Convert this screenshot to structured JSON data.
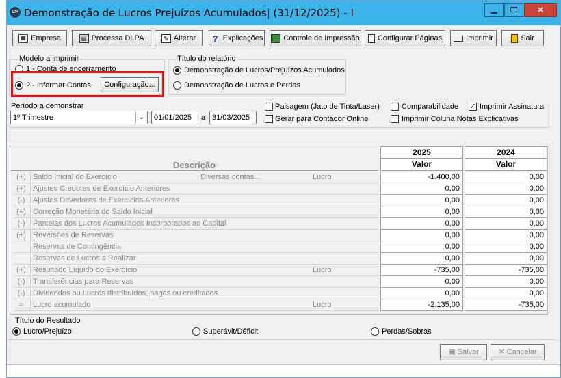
{
  "window": {
    "title": "Demonstração de Lucros Prejuízos Acumulados| (31/12/2025) - I",
    "app_icon": "CP"
  },
  "toolbar": {
    "buttons": [
      {
        "label": "Empresa",
        "icon": "calendar-icon"
      },
      {
        "label": "Processa DLPA",
        "icon": "calculator-icon"
      },
      {
        "label": "Alterar",
        "icon": "edit-icon"
      },
      {
        "label": "Explicações",
        "icon": "help-icon"
      },
      {
        "label": "Controle de Impressão",
        "icon": "monitor-icon"
      },
      {
        "label": "Configurar Páginas",
        "icon": "page-icon"
      },
      {
        "label": "Imprimir",
        "icon": "printer-icon"
      },
      {
        "label": "Sair",
        "icon": "exit-icon"
      }
    ]
  },
  "modelo": {
    "group_label": "Modelo a imprimir",
    "option1": "1 - Conta de encerramento",
    "option2": "2 - Informar Contas",
    "selected": 2,
    "config_button": "Configuração..."
  },
  "titulo": {
    "group_label": "Título do relatório",
    "option1": "Demonstração de Lucros/Prejuízos Acumulados",
    "option2": "Demonstração de Lucros e Perdas",
    "selected": 1
  },
  "periodo": {
    "label": "Período a demonstrar",
    "value": "1º Trimestre",
    "date_from": "01/01/2025",
    "date_sep": "a",
    "date_to": "31/03/2025"
  },
  "options": {
    "paisagem": {
      "label": "Paisagem (Jato de Tinta/Laser)",
      "checked": false
    },
    "contador_online": {
      "label": "Gerar para Contador Online",
      "checked": false
    },
    "comparabilidade": {
      "label": "Comparabilidade",
      "checked": false
    },
    "imprimir_coluna": {
      "label": "Imprimir Coluna Notas Explicativas",
      "checked": false
    },
    "imprimir_assinatura": {
      "label": "Imprimir Assinatura",
      "checked": true
    }
  },
  "grid": {
    "desc_header": "Descrição",
    "year1": "2025",
    "year2": "2024",
    "value_header": "Valor",
    "rows": [
      {
        "sign": "(+)",
        "desc": "Saldo Inicial do Exercício",
        "extra": "Diversas contas...",
        "tipo": "Lucro",
        "v1": "-1.400,00",
        "v2": "0,00"
      },
      {
        "sign": "(+)",
        "desc": "Ajustes Credores de Exercício Anteriores",
        "extra": "",
        "tipo": "",
        "v1": "0,00",
        "v2": "0,00"
      },
      {
        "sign": "(-)",
        "desc": "Ajustes Devedores de Exercícios Anteriores",
        "extra": "",
        "tipo": "",
        "v1": "0,00",
        "v2": "0,00"
      },
      {
        "sign": "(+)",
        "desc": "Correção Monetária do Saldo Inicial",
        "extra": "",
        "tipo": "",
        "v1": "0,00",
        "v2": "0,00"
      },
      {
        "sign": "(-)",
        "desc": "Parcelas dos Lucros Acumulados Incorporados ao Capital",
        "extra": "",
        "tipo": "",
        "v1": "0,00",
        "v2": "0,00"
      },
      {
        "sign": "(+)",
        "desc": "Reversões de Reservas",
        "extra": "",
        "tipo": "",
        "v1": "0,00",
        "v2": "0,00"
      },
      {
        "sign": "",
        "desc": "Reservas de Contingência",
        "extra": "",
        "tipo": "",
        "v1": "0,00",
        "v2": "0,00"
      },
      {
        "sign": "",
        "desc": "Reservas de Lucros a Realizar",
        "extra": "",
        "tipo": "",
        "v1": "0,00",
        "v2": "0,00"
      },
      {
        "sign": "(+)",
        "desc": "Resultado Líquido do Exercício",
        "extra": "",
        "tipo": "Lucro",
        "v1": "-735,00",
        "v2": "-735,00"
      },
      {
        "sign": "(-)",
        "desc": "Transferências para Reservas",
        "extra": "",
        "tipo": "",
        "v1": "0,00",
        "v2": "0,00"
      },
      {
        "sign": "(-)",
        "desc": "Dividendos ou Lucros distribuídos, pagos ou creditados",
        "extra": "",
        "tipo": "",
        "v1": "0,00",
        "v2": "0,00"
      },
      {
        "sign": "=",
        "desc": "Lucro acumulado",
        "extra": "",
        "tipo": "Lucro",
        "v1": "-2.135,00",
        "v2": "-735,00"
      }
    ]
  },
  "resultado": {
    "label": "Título do Resultado",
    "option1": "Lucro/Prejuízo",
    "option2": "Superávit/Déficit",
    "option3": "Perdas/Sobras",
    "selected": 1
  },
  "actions": {
    "save": "Salvar",
    "cancel": "Cancelar"
  }
}
